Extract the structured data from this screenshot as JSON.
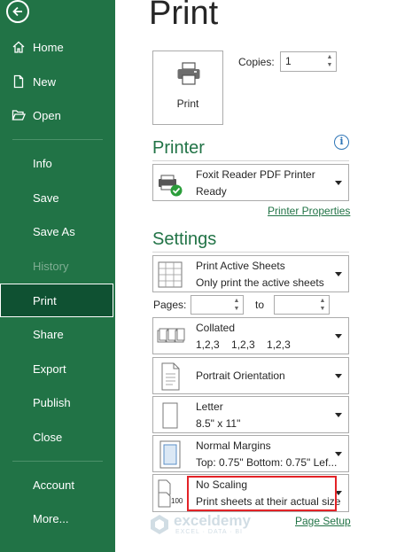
{
  "sidebar": {
    "items": [
      {
        "label": "Home",
        "icon": "home-icon"
      },
      {
        "label": "New",
        "icon": "new-document-icon"
      },
      {
        "label": "Open",
        "icon": "open-folder-icon"
      },
      {
        "label": "Info"
      },
      {
        "label": "Save"
      },
      {
        "label": "Save As"
      },
      {
        "label": "History",
        "disabled": true
      },
      {
        "label": "Print",
        "active": true
      },
      {
        "label": "Share"
      },
      {
        "label": "Export"
      },
      {
        "label": "Publish"
      },
      {
        "label": "Close"
      },
      {
        "label": "Account"
      },
      {
        "label": "More..."
      }
    ]
  },
  "main": {
    "title": "Print",
    "print_button_label": "Print",
    "copies": {
      "label": "Copies:",
      "value": "1"
    },
    "printer": {
      "heading": "Printer",
      "name": "Foxit Reader PDF Printer",
      "status": "Ready",
      "properties_link": "Printer Properties"
    },
    "settings": {
      "heading": "Settings",
      "print_what": {
        "title": "Print Active Sheets",
        "subtitle": "Only print the active sheets"
      },
      "pages": {
        "label": "Pages:",
        "to_label": "to",
        "from_value": "",
        "to_value": ""
      },
      "collation": {
        "title": "Collated",
        "subtitle": "1,2,3    1,2,3    1,2,3"
      },
      "orientation": {
        "title": "Portrait Orientation"
      },
      "paper": {
        "title": "Letter",
        "subtitle": "8.5\" x 11\""
      },
      "margins": {
        "title": "Normal Margins",
        "subtitle": "Top: 0.75\" Bottom: 0.75\" Lef..."
      },
      "scaling": {
        "title": "No Scaling",
        "subtitle": "Print sheets at their actual size",
        "icon_badge": "100"
      },
      "page_setup_link": "Page Setup"
    }
  },
  "watermark": {
    "name": "exceldemy",
    "tagline": "EXCEL · DATA · BI"
  },
  "colors": {
    "sidebar": "#217346",
    "active_item": "#0f5132",
    "accent": "#217346",
    "highlight": "#e32227"
  }
}
